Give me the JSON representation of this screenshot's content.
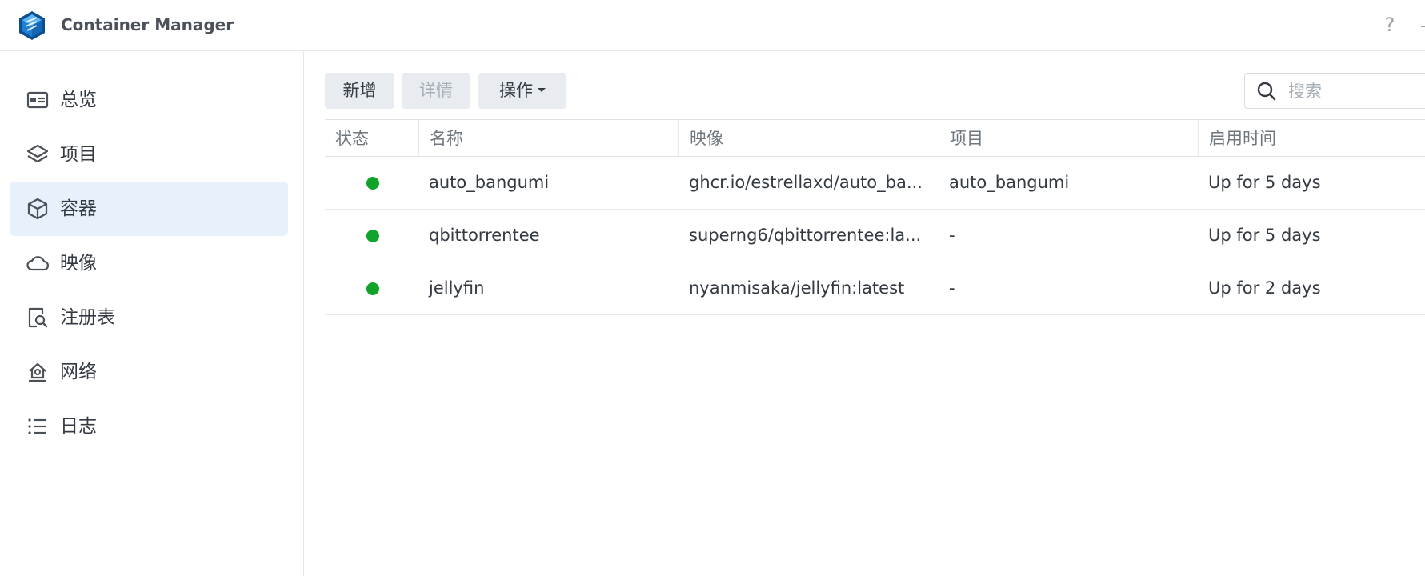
{
  "app": {
    "title": "Container Manager",
    "help_label": "?"
  },
  "sidebar": {
    "items": [
      {
        "label": "总览",
        "icon": "overview-icon"
      },
      {
        "label": "项目",
        "icon": "project-layers-icon"
      },
      {
        "label": "容器",
        "icon": "container-cube-icon",
        "active": true
      },
      {
        "label": "映像",
        "icon": "image-cloud-icon"
      },
      {
        "label": "注册表",
        "icon": "registry-search-icon"
      },
      {
        "label": "网络",
        "icon": "network-home-icon"
      },
      {
        "label": "日志",
        "icon": "log-list-icon"
      }
    ]
  },
  "toolbar": {
    "add_label": "新增",
    "details_label": "详情",
    "actions_label": "操作"
  },
  "search": {
    "placeholder": "搜索",
    "value": ""
  },
  "table": {
    "headers": {
      "status": "状态",
      "name": "名称",
      "image": "映像",
      "project": "项目",
      "uptime": "启用时间"
    },
    "rows": [
      {
        "status": "running",
        "name": "auto_bangumi",
        "image": "ghcr.io/estrellaxd/auto_ba...",
        "project": "auto_bangumi",
        "uptime": "Up for 5 days"
      },
      {
        "status": "running",
        "name": "qbittorrentee",
        "image": "superng6/qbittorrentee:la...",
        "project": "-",
        "uptime": "Up for 5 days"
      },
      {
        "status": "running",
        "name": "jellyfin",
        "image": "nyanmisaka/jellyfin:latest",
        "project": "-",
        "uptime": "Up for 2 days"
      }
    ]
  },
  "colors": {
    "accent": "#1a8fe3",
    "status_running": "#0fa32a",
    "active_nav_bg": "#e6f1fc"
  }
}
